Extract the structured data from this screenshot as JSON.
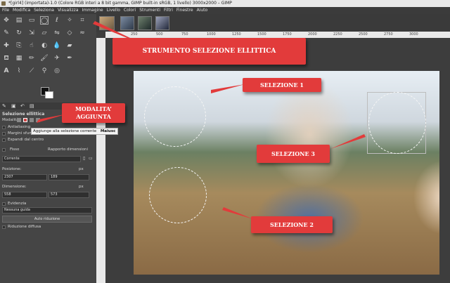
{
  "window": {
    "title": "*[girl4] (importata)-1.0 (Colore RGB interi a 8 bit gamma, GIMP built-in sRGB, 1 livello) 3000x2000 – GIMP"
  },
  "menu": [
    "File",
    "Modifica",
    "Seleziona",
    "Visualizza",
    "Immagine",
    "Livello",
    "Colori",
    "Strumenti",
    "Filtri",
    "Finestre",
    "Aiuto"
  ],
  "ruler": {
    "ticks": [
      "250",
      "500",
      "750",
      "1000",
      "1250",
      "1500",
      "1750",
      "2000",
      "2250",
      "2500",
      "2750",
      "3000"
    ]
  },
  "tool_options": {
    "title": "Selezione ellittica",
    "mode_label": "Modalità:",
    "antialiasing": "Antialiasing",
    "feather": "Margini sfumati",
    "expand_center": "Espandi dal centro",
    "fixed": "Fisso",
    "fixed_value": "Rapporto dimensioni",
    "current": "Corrente",
    "position_label": "Posizione:",
    "position_x": "2307",
    "position_y": "189",
    "position_unit": "px",
    "size_label": "Dimensione:",
    "size_w": "558",
    "size_h": "573",
    "size_unit": "px",
    "highlight": "Evidenzia",
    "guides": "Nessuna guida",
    "auto_shrink": "Auto riduzione",
    "shrink_merged": "Riduzione diffusa"
  },
  "tooltip": {
    "text": "Aggiunge alla selezione corrente",
    "shortcut": "Maiusc"
  },
  "callouts": {
    "tool": "STRUMENTO SELEZIONE ELLITTICA",
    "mode": "MODALITA’ AGGIUNTA",
    "sel1": "SELEZIONE 1",
    "sel2": "SELEZIONE 2",
    "sel3": "SELEZIONE 3"
  },
  "colors": {
    "callout": "#e23b3b",
    "panel": "#454545",
    "canvas": "#3d3d3d"
  }
}
